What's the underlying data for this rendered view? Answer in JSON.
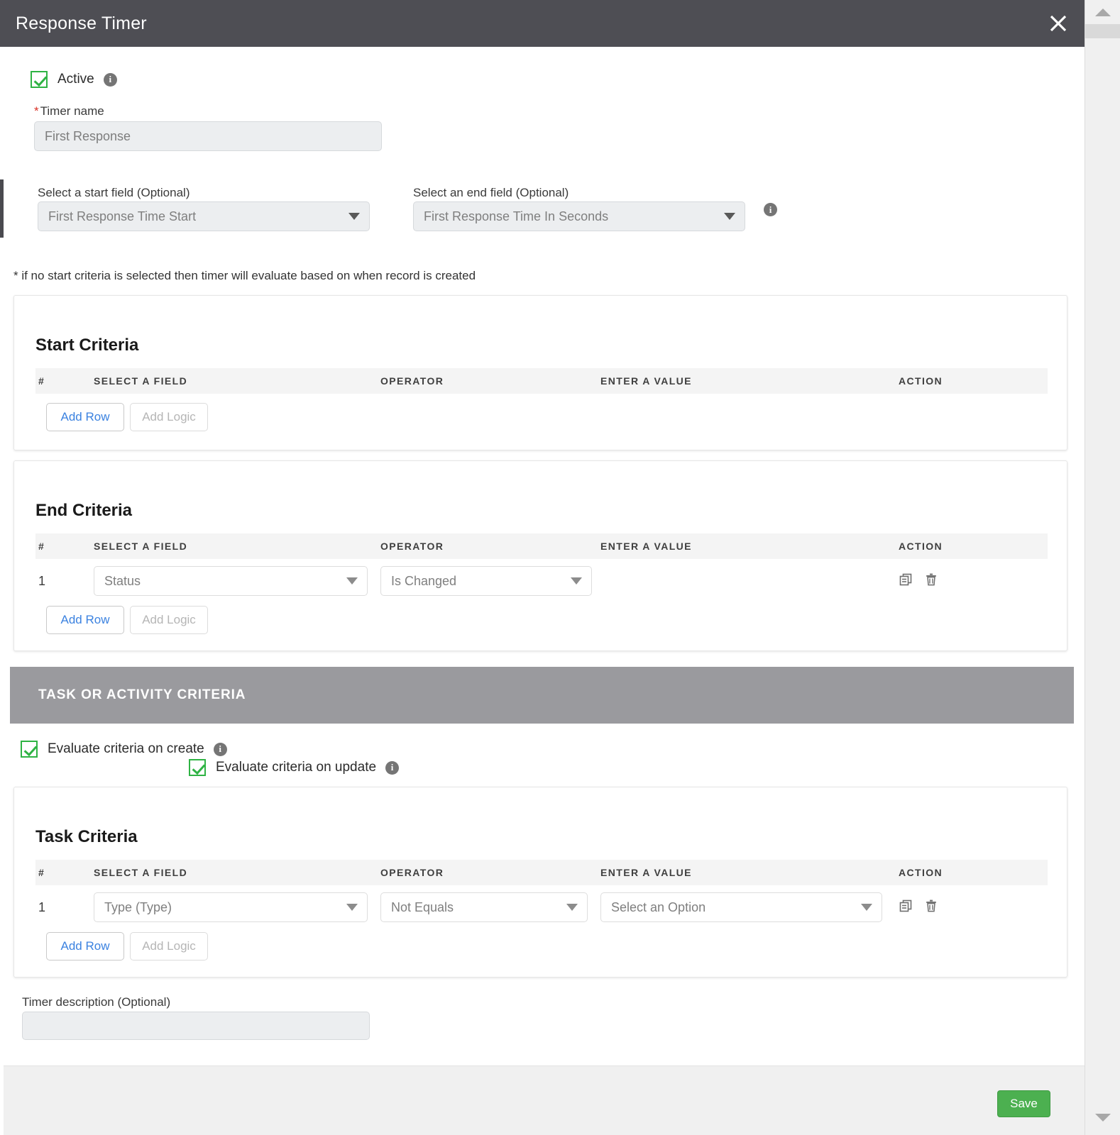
{
  "window": {
    "title": "Response Timer",
    "close_icon": "close-icon"
  },
  "form": {
    "active": {
      "label": "Active",
      "checked": true,
      "info_icon": "info-icon"
    },
    "timer_name": {
      "label": "Timer name",
      "required_marker": "*",
      "value": "First Response",
      "placeholder": "First Response"
    },
    "start_field": {
      "label": "Select a start field (Optional)",
      "value": "First Response Time Start"
    },
    "end_field": {
      "label": "Select an end field (Optional)",
      "value": "First Response Time In Seconds",
      "info_icon": "info-icon"
    },
    "note": "* if no start criteria is selected then timer will evaluate based on when record is created",
    "description": {
      "label": "Timer description (Optional)",
      "value": "",
      "placeholder": ""
    }
  },
  "columns": {
    "num": "#",
    "field": "SELECT A FIELD",
    "operator": "OPERATOR",
    "value": "ENTER A VALUE",
    "action": "ACTION"
  },
  "buttons": {
    "add_row": "Add Row",
    "add_logic": "Add Logic",
    "save": "Save"
  },
  "start_criteria": {
    "title": "Start Criteria",
    "rows": []
  },
  "end_criteria": {
    "title": "End Criteria",
    "rows": [
      {
        "num": "1",
        "field": "Status",
        "operator": "Is Changed",
        "value": "",
        "actions": [
          "copy-icon",
          "trash-icon"
        ]
      }
    ]
  },
  "task_section": {
    "bar_title": "TASK OR ACTIVITY CRITERIA",
    "evaluate_on_create": {
      "label": "Evaluate criteria on create",
      "checked": true,
      "info_icon": "info-icon"
    },
    "evaluate_on_update": {
      "label": "Evaluate criteria on update",
      "checked": true,
      "info_icon": "info-icon"
    },
    "task_criteria": {
      "title": "Task Criteria",
      "rows": [
        {
          "num": "1",
          "field": "Type (Type)",
          "operator": "Not Equals",
          "value": "Select an Option",
          "actions": [
            "copy-icon",
            "trash-icon"
          ]
        }
      ]
    }
  },
  "colors": {
    "titlebar": "#4e4e54",
    "accent_green": "#4cb050",
    "checkbox_green": "#2fb344",
    "link_blue": "#3b82e0",
    "section_bar_grey": "#9a9a9e",
    "required_red": "#d93025"
  }
}
